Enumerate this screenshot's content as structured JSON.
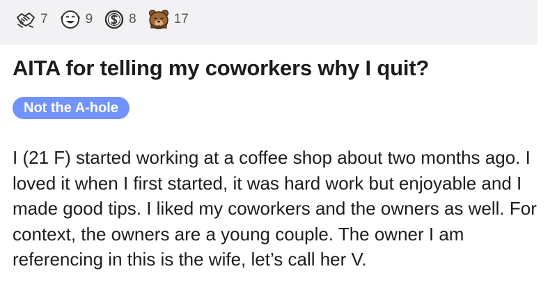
{
  "awards": [
    {
      "icon": "handshake-award-icon",
      "count": "7"
    },
    {
      "icon": "laughing-face-award-icon",
      "count": "9"
    },
    {
      "icon": "money-bag-award-icon",
      "count": "8"
    },
    {
      "icon": "facepalm-bear-award-icon",
      "count": "17"
    }
  ],
  "post": {
    "title": "AITA for telling my coworkers why I quit?",
    "flair": "Not the A-hole",
    "body": "I (21 F) started working at a coffee shop about two months ago. I loved it when I first started, it was hard work but enjoyable and I made good tips. I liked my coworkers and the owners as well. For context, the owners are a young couple. The owner I am referencing in this is the wife, let’s call her V."
  },
  "colors": {
    "award_bar_bg": "#f2f2f4",
    "flair_bg": "#7193ff",
    "flair_text": "#ffffff",
    "text": "#1c1c1c"
  }
}
